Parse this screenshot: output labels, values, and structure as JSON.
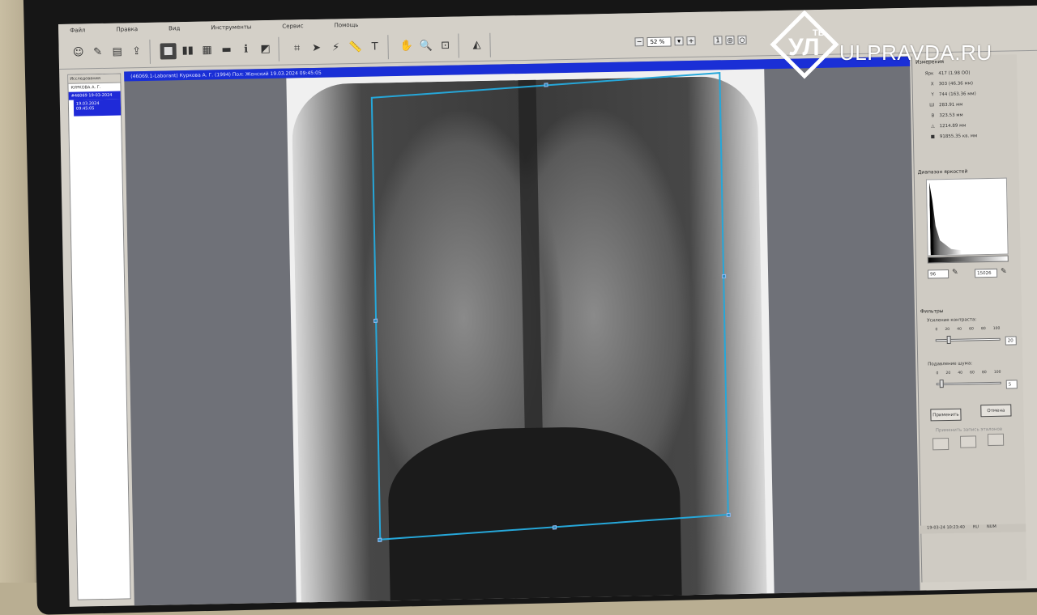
{
  "menu": [
    "Файл",
    "Правка",
    "Вид",
    "Инструменты",
    "Сервис",
    "Помощь"
  ],
  "toolbar": {
    "zoom_value": "52 %",
    "text_tool": "T"
  },
  "tree": {
    "header": "Исследования",
    "patient": "КУРКОВА А. Г.",
    "study": "#46069 19-03-2024",
    "image_date": "19.03.2024",
    "image_time": "09:45:05"
  },
  "viewer": {
    "title": "(46069.1-Laborant)   Куркова А. Г. (1994) Пол: Женский   19.03.2024 09:45:05"
  },
  "measure": {
    "title": "Измерения",
    "rows": [
      {
        "k": "Ярк",
        "v": "417 (1.98 ОО)"
      },
      {
        "k": "X",
        "v": "303 (46.36 мм)"
      },
      {
        "k": "Y",
        "v": "744 (163.36 мм)"
      },
      {
        "k": "Ш",
        "v": "283.91 мм"
      },
      {
        "k": "В",
        "v": "323.53 мм"
      },
      {
        "k": "△",
        "v": "1214.89 мм"
      },
      {
        "k": "■",
        "v": "91855.35 кв. мм"
      }
    ]
  },
  "brightness": {
    "title": "Диапазон яркостей",
    "min": "96",
    "max": "15026"
  },
  "filters": {
    "title": "Фильтры",
    "contrast_label": "Усиление контраста:",
    "contrast_value": "20",
    "noise_label": "Подавление шума:",
    "noise_value": "5",
    "ticks": [
      "0",
      "20",
      "40",
      "60",
      "80",
      "100"
    ],
    "apply": "Применить",
    "cancel": "Отмена",
    "preset_label": "Применить запись эталонов"
  },
  "status": {
    "datetime": "19-03-24 10:23:40",
    "lang": "RU",
    "num": "NUM"
  },
  "watermark": {
    "logo": "УЛ",
    "logo_sup": "ТВ",
    "brand": "ULPRAVDA.RU"
  },
  "colors": {
    "accent": "#1a2fd6",
    "selection": "#26a7d9"
  }
}
